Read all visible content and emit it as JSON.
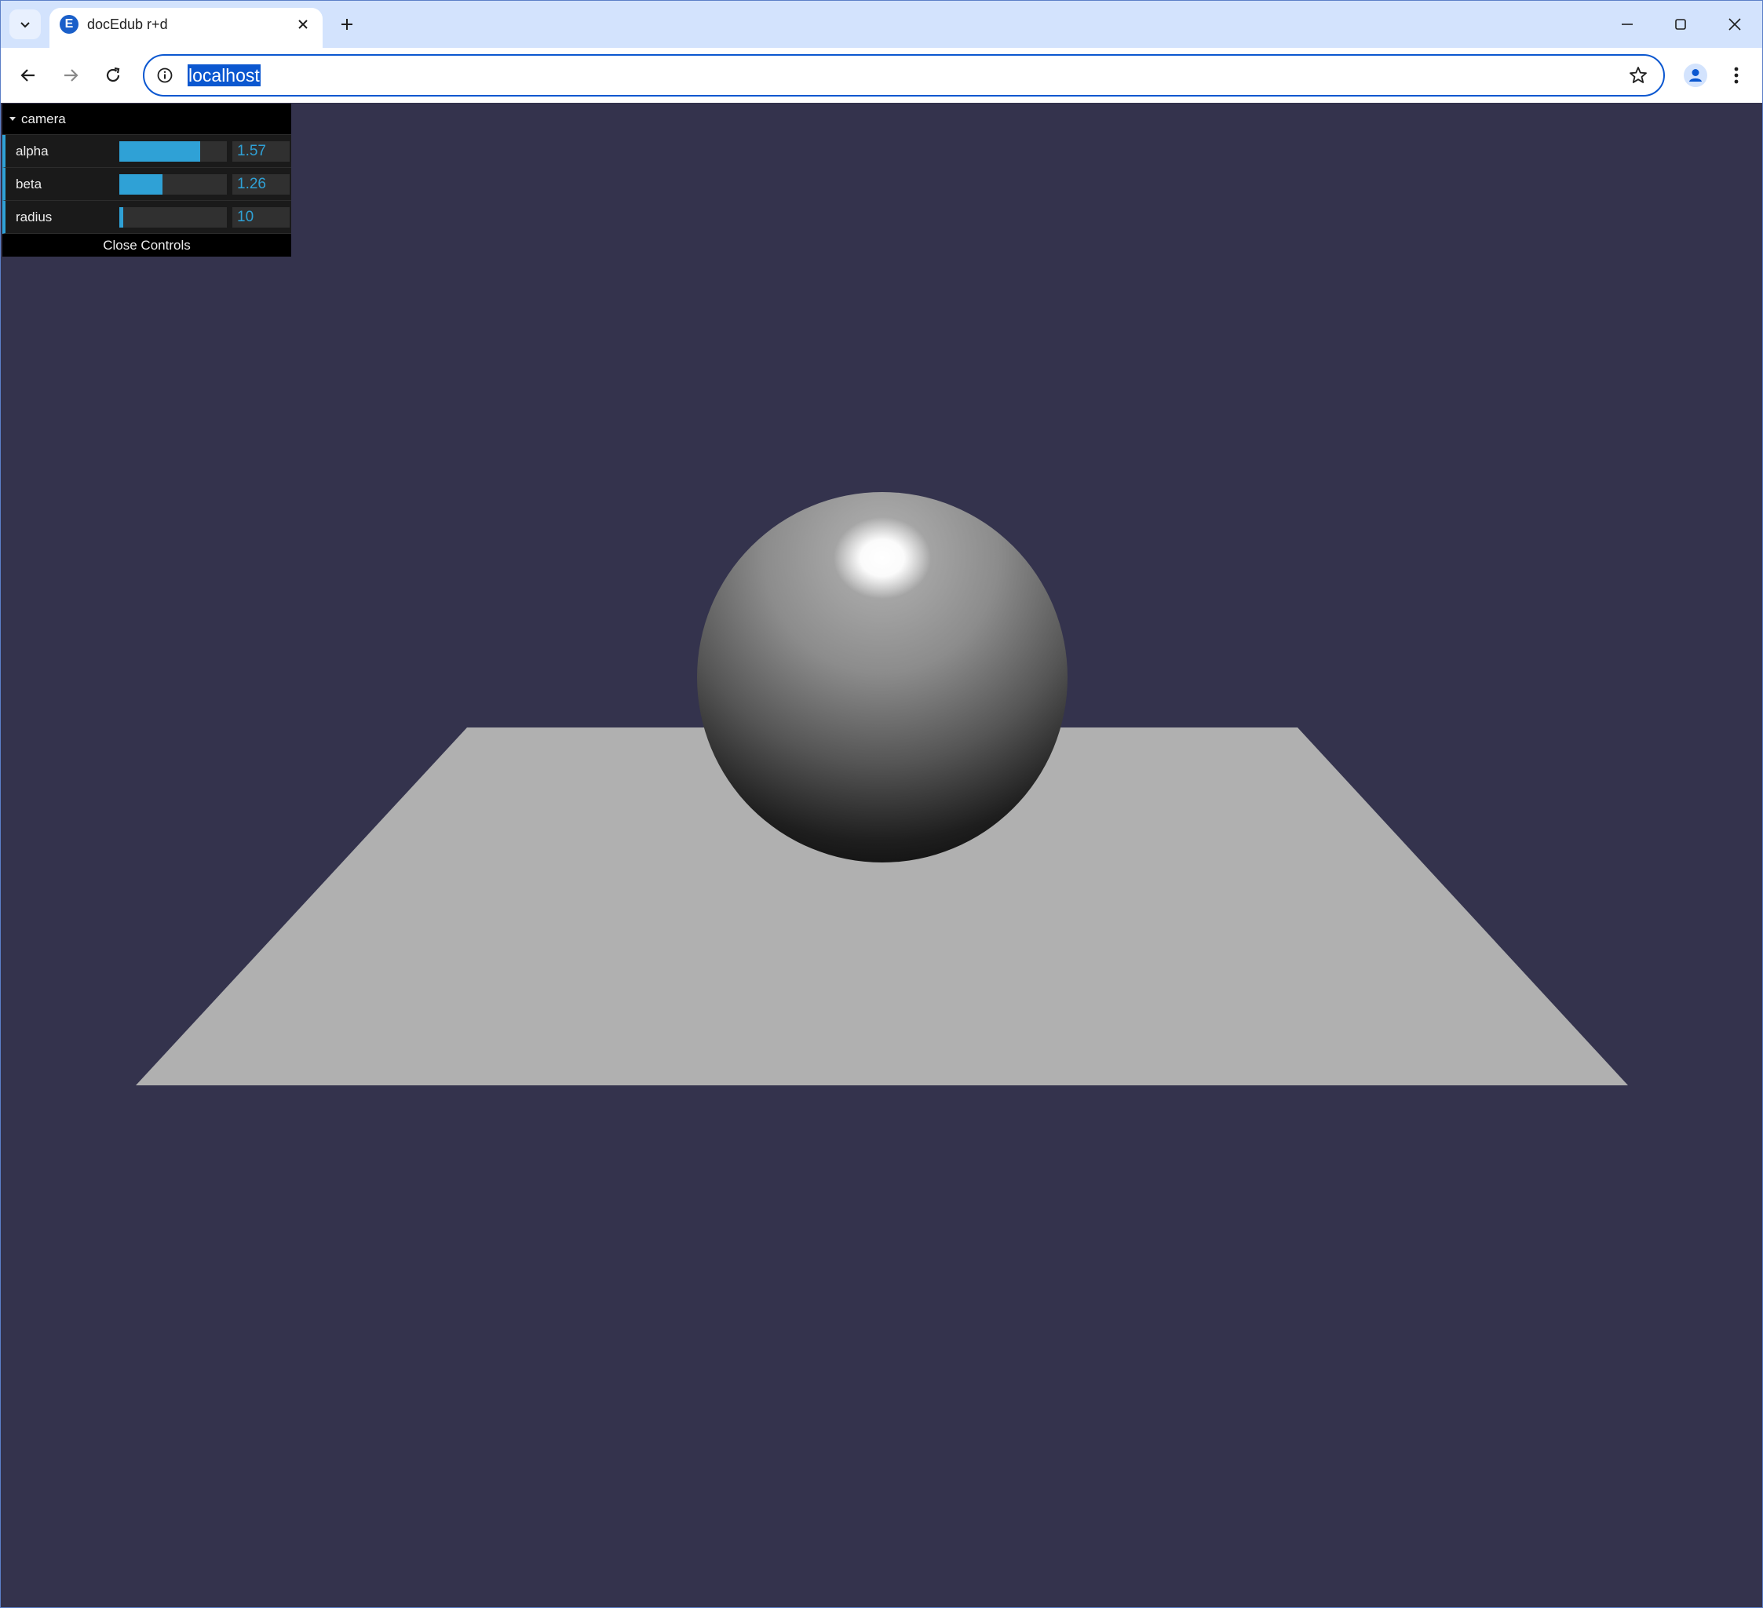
{
  "browser": {
    "tab_title": "docEdub r+d",
    "favicon_letter": "E",
    "url": "localhost"
  },
  "icons": {
    "tab_search": "chevron-down-icon",
    "tab_close": "close-icon",
    "new_tab": "plus-icon",
    "minimize": "minimize-icon",
    "maximize": "maximize-icon",
    "close_window": "close-icon",
    "back": "arrow-left-icon",
    "forward": "arrow-right-icon",
    "reload": "reload-icon",
    "site_info": "info-icon",
    "bookmark": "star-icon",
    "profile": "person-icon",
    "menu": "kebab-menu-icon"
  },
  "gui": {
    "folder_title": "camera",
    "controls": [
      {
        "label": "alpha",
        "value": "1.57",
        "fill_fraction": 0.75
      },
      {
        "label": "beta",
        "value": "1.26",
        "fill_fraction": 0.4
      },
      {
        "label": "radius",
        "value": "10",
        "fill_fraction": 0.04
      }
    ],
    "close_label": "Close Controls"
  },
  "colors": {
    "background": "#34334d",
    "ground": "#b0b0b0",
    "slider_accent": "#2fa1d6",
    "omnibox_accent": "#0b57d0"
  }
}
